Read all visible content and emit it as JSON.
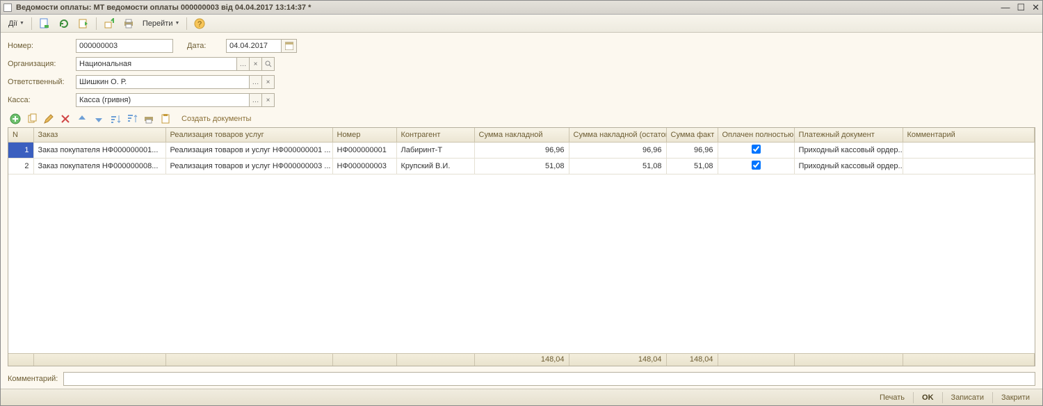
{
  "window": {
    "title": "Ведомости оплаты: МТ ведомости оплаты 000000003 від 04.04.2017 13:14:37 *"
  },
  "toolbar": {
    "actions_label": "Дії",
    "goto_label": "Перейти"
  },
  "form": {
    "number_label": "Номер:",
    "number_value": "000000003",
    "date_label": "Дата:",
    "date_value": "04.04.2017",
    "org_label": "Организация:",
    "org_value": "Национальная",
    "responsible_label": "Ответственный:",
    "responsible_value": "Шишкин О. Р.",
    "cash_label": "Касса:",
    "cash_value": "Касса (гривня)"
  },
  "row_toolbar": {
    "create_docs": "Создать документы"
  },
  "table": {
    "headers": {
      "n": "N",
      "order": "Заказ",
      "realization": "Реализация товаров услуг",
      "number": "Номер",
      "counterparty": "Контрагент",
      "sum_invoice": "Сумма накладной",
      "sum_invoice_rest": "Сумма накладной (остаток)",
      "sum_fact": "Сумма факт",
      "paid_full": "Оплачен полностью",
      "pay_doc": "Платежный документ",
      "comment": "Комментарий"
    },
    "rows": [
      {
        "n": "1",
        "order": "Заказ покупателя НФ000000001...",
        "realization": "Реализация товаров и услуг НФ000000001 ...",
        "number": "НФ000000001",
        "counterparty": "Лабиринт-Т",
        "sum_invoice": "96,96",
        "sum_rest": "96,96",
        "sum_fact": "96,96",
        "paid": true,
        "pay_doc": "Приходный кассовый ордер...",
        "comment": ""
      },
      {
        "n": "2",
        "order": "Заказ покупателя НФ000000008...",
        "realization": "Реализация товаров и услуг НФ000000003 ...",
        "number": "НФ000000003",
        "counterparty": "Крупский В.И.",
        "sum_invoice": "51,08",
        "sum_rest": "51,08",
        "sum_fact": "51,08",
        "paid": true,
        "pay_doc": "Приходный кассовый ордер...",
        "comment": ""
      }
    ],
    "totals": {
      "sum_invoice": "148,04",
      "sum_rest": "148,04",
      "sum_fact": "148,04"
    }
  },
  "comment": {
    "label": "Комментарий:",
    "value": ""
  },
  "buttons": {
    "print": "Печать",
    "ok": "OK",
    "save": "Записати",
    "close": "Закрити"
  }
}
